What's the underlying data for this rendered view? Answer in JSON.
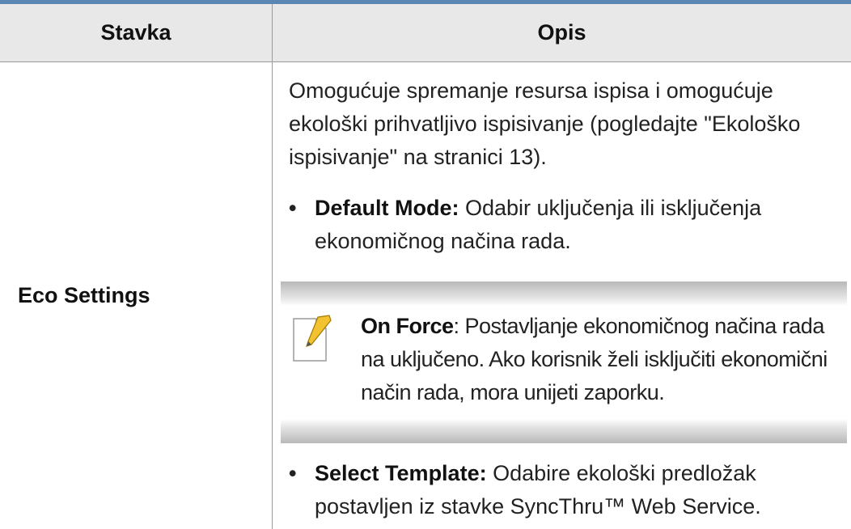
{
  "table": {
    "headers": {
      "item": "Stavka",
      "description": "Opis"
    },
    "rows": [
      {
        "item": "Eco Settings",
        "intro": "Omogućuje spremanje resursa ispisa i omogućuje ekološki prihvatljivo ispisivanje (pogledajte \"Ekološko ispisivanje\" na stranici 13).",
        "bullets": [
          {
            "term": "Default Mode:",
            "text": " Odabir uključenja ili isključenja ekonomičnog načina rada."
          },
          {
            "term": "Select Template:",
            "text": " Odabire ekološki predložak postavljen iz stavke SyncThru™ Web Service."
          }
        ],
        "note": {
          "icon": "note-pencil-icon",
          "term": "On Force",
          "text": ": Postavljanje ekonomičnog načina rada na uključeno. Ako korisnik želi isključiti ekonomični način rada, mora unijeti zaporku."
        }
      }
    ]
  },
  "colors": {
    "top_rule": "#5a86b4",
    "header_bg": "#e8e8e8",
    "note_bar": "#b9b9b9",
    "icon_accent": "#f2c230"
  }
}
